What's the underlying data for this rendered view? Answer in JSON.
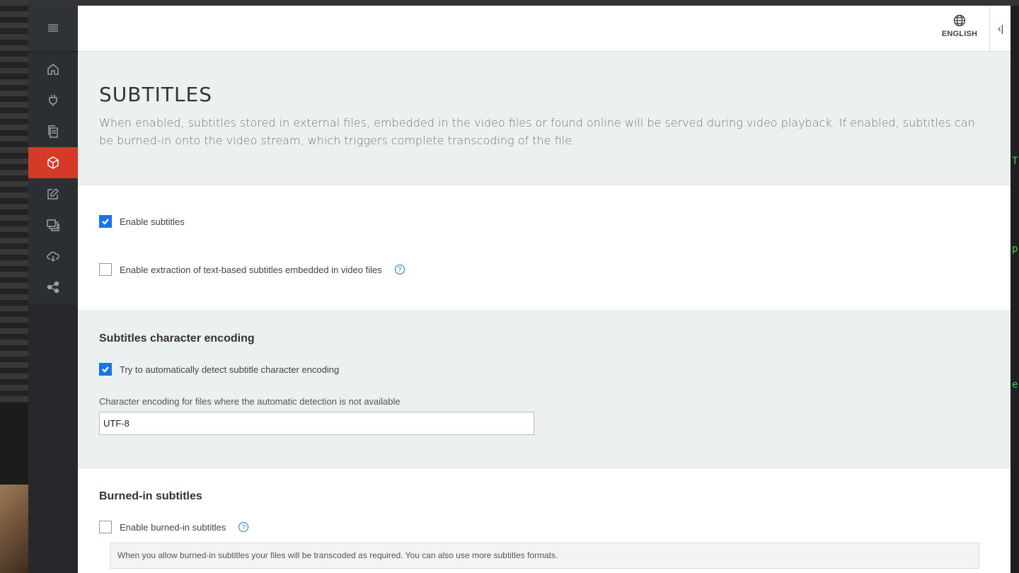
{
  "sidebar": {
    "menu_icon": "hamburger-icon",
    "items": [
      {
        "id": "home",
        "icon": "home-icon",
        "active": false
      },
      {
        "id": "plugins",
        "icon": "plug-icon",
        "active": false
      },
      {
        "id": "files",
        "icon": "documents-icon",
        "active": false
      },
      {
        "id": "subtitles",
        "icon": "cube-icon",
        "active": true
      },
      {
        "id": "edit",
        "icon": "edit-icon",
        "active": false
      },
      {
        "id": "layers",
        "icon": "layers-icon",
        "active": false
      },
      {
        "id": "cloud",
        "icon": "cloud-icon",
        "active": false
      },
      {
        "id": "share",
        "icon": "share-icon",
        "active": false
      }
    ],
    "active_color": "#d43a26"
  },
  "header": {
    "language_label": "ENGLISH",
    "language_icon": "globe-icon",
    "collapse_label": "‹|"
  },
  "hero": {
    "title": "SUBTITLES",
    "description": "When enabled, subtitles stored in external files, embedded in the video files or found online will be served during video playback. If enabled, subtitles can be burned-in onto the video stream, which triggers complete transcoding of the file."
  },
  "general": {
    "enable_subtitles": {
      "label": "Enable subtitles",
      "checked": true
    },
    "enable_extraction": {
      "label": "Enable extraction of text-based subtitles embedded in video files",
      "checked": false,
      "help": "?"
    }
  },
  "encoding": {
    "title": "Subtitles character encoding",
    "auto_detect": {
      "label": "Try to automatically detect subtitle character encoding",
      "checked": true
    },
    "fallback_label": "Character encoding for files where the automatic detection is not available",
    "fallback_value": "UTF-8"
  },
  "burned_in": {
    "title": "Burned-in subtitles",
    "enable": {
      "label": "Enable burned-in subtitles",
      "checked": false,
      "help": "?"
    },
    "info": "When you allow burned-in subtitles your files will be transcoded as required. You can also use more subtitles formats."
  },
  "colors": {
    "accent": "#1a73e8",
    "section_bg": "#edf0f1",
    "sidebar_bg": "#2b2e33"
  }
}
